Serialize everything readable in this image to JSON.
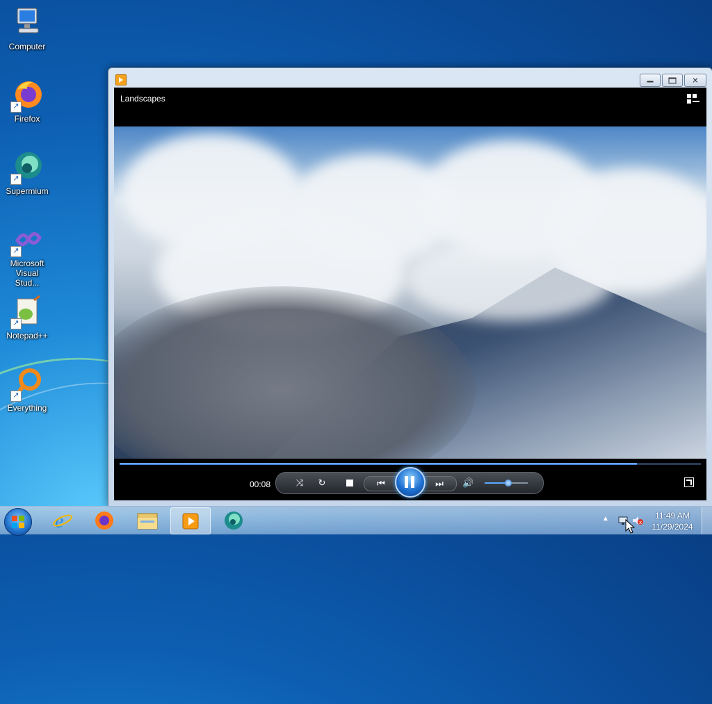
{
  "desktop": {
    "icons": [
      {
        "label": "Computer"
      },
      {
        "label": "Firefox"
      },
      {
        "label": "Supermium"
      },
      {
        "label": "Microsoft Visual Stud..."
      },
      {
        "label": "Notepad++"
      },
      {
        "label": "Everything"
      }
    ]
  },
  "player": {
    "title": "Landscapes",
    "elapsed": "00:08",
    "progress": 0.89,
    "volume": 0.55,
    "state": "playing"
  },
  "taskbar": {
    "pinned": [
      "internet-explorer",
      "firefox",
      "file-explorer",
      "windows-media-player",
      "supermium"
    ],
    "active": "windows-media-player",
    "clock": {
      "time": "11:49 AM",
      "date": "11/29/2024"
    }
  },
  "colors": {
    "accent": "#1d6fd0",
    "player_bg": "#000000",
    "seek": "#3a78d6"
  }
}
